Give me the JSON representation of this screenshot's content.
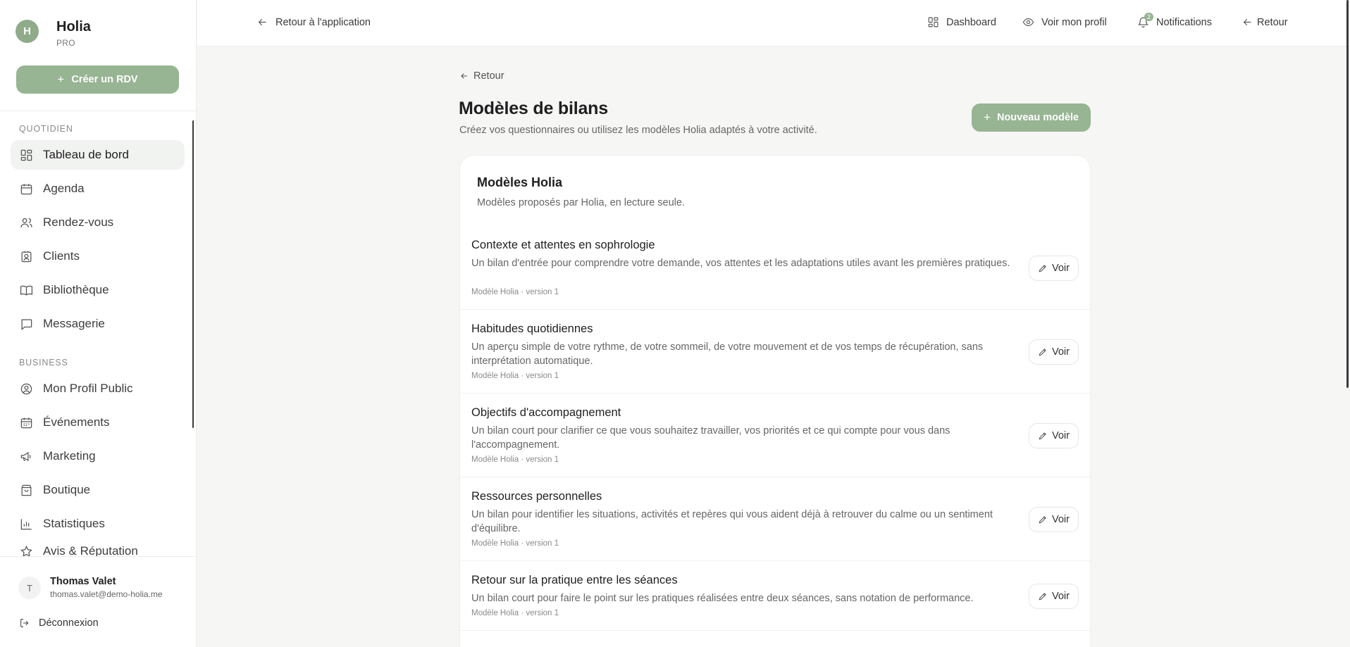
{
  "brand": {
    "initial": "H",
    "name": "Holia",
    "tier": "PRO"
  },
  "sidebar": {
    "create_button": "Créer un RDV",
    "section_daily": "QUOTIDIEN",
    "section_business": "BUSINESS",
    "items": [
      {
        "label": "Tableau de bord",
        "icon": "dashboard-icon"
      },
      {
        "label": "Agenda",
        "icon": "calendar-icon"
      },
      {
        "label": "Rendez-vous",
        "icon": "users-icon"
      },
      {
        "label": "Clients",
        "icon": "contact-icon"
      },
      {
        "label": "Bibliothèque",
        "icon": "book-icon"
      },
      {
        "label": "Messagerie",
        "icon": "message-icon"
      },
      {
        "label": "Mon Profil Public",
        "icon": "user-circle-icon"
      },
      {
        "label": "Événements",
        "icon": "calendar-days-icon"
      },
      {
        "label": "Marketing",
        "icon": "megaphone-icon"
      },
      {
        "label": "Boutique",
        "icon": "shopping-bag-icon"
      },
      {
        "label": "Statistiques",
        "icon": "bar-chart-icon"
      },
      {
        "label": "Avis & Réputation",
        "icon": "star-icon"
      }
    ],
    "user": {
      "initial": "T",
      "name": "Thomas Valet",
      "email": "thomas.valet@demo-holia.me"
    },
    "logout": "Déconnexion"
  },
  "topbar": {
    "back_to_app": "Retour à l'application",
    "dashboard": "Dashboard",
    "view_profile": "Voir mon profil",
    "notifications": "Notifications",
    "notifications_count": "2",
    "back": "Retour"
  },
  "main": {
    "back": "Retour",
    "title": "Modèles de bilans",
    "subtitle": "Créez vos questionnaires ou utilisez les modèles Holia adaptés à votre activité.",
    "new_button": "Nouveau modèle",
    "card": {
      "title": "Modèles Holia",
      "subtitle": "Modèles proposés par Holia, en lecture seule.",
      "view_label": "Voir",
      "templates": [
        {
          "title": "Contexte et attentes en sophrologie",
          "description": "Un bilan d'entrée pour comprendre votre demande, vos attentes et les adaptations utiles avant les premières pratiques.",
          "meta": "Modèle Holia · version 1"
        },
        {
          "title": "Habitudes quotidiennes",
          "description": "Un aperçu simple de votre rythme, de votre sommeil, de votre mouvement et de vos temps de récupération, sans interprétation automatique.",
          "meta": "Modèle Holia · version 1"
        },
        {
          "title": "Objectifs d'accompagnement",
          "description": "Un bilan court pour clarifier ce que vous souhaitez travailler, vos priorités et ce qui compte pour vous dans l'accompagnement.",
          "meta": "Modèle Holia · version 1"
        },
        {
          "title": "Ressources personnelles",
          "description": "Un bilan pour identifier les situations, activités et repères qui vous aident déjà à retrouver du calme ou un sentiment d'équilibre.",
          "meta": "Modèle Holia · version 1"
        },
        {
          "title": "Retour sur la pratique entre les séances",
          "description": "Un bilan court pour faire le point sur les pratiques réalisées entre deux séances, sans notation de performance.",
          "meta": "Modèle Holia · version 1"
        }
      ]
    }
  },
  "colors": {
    "accent": "#97b493",
    "background": "#f6f6f5",
    "card": "#ffffff"
  }
}
